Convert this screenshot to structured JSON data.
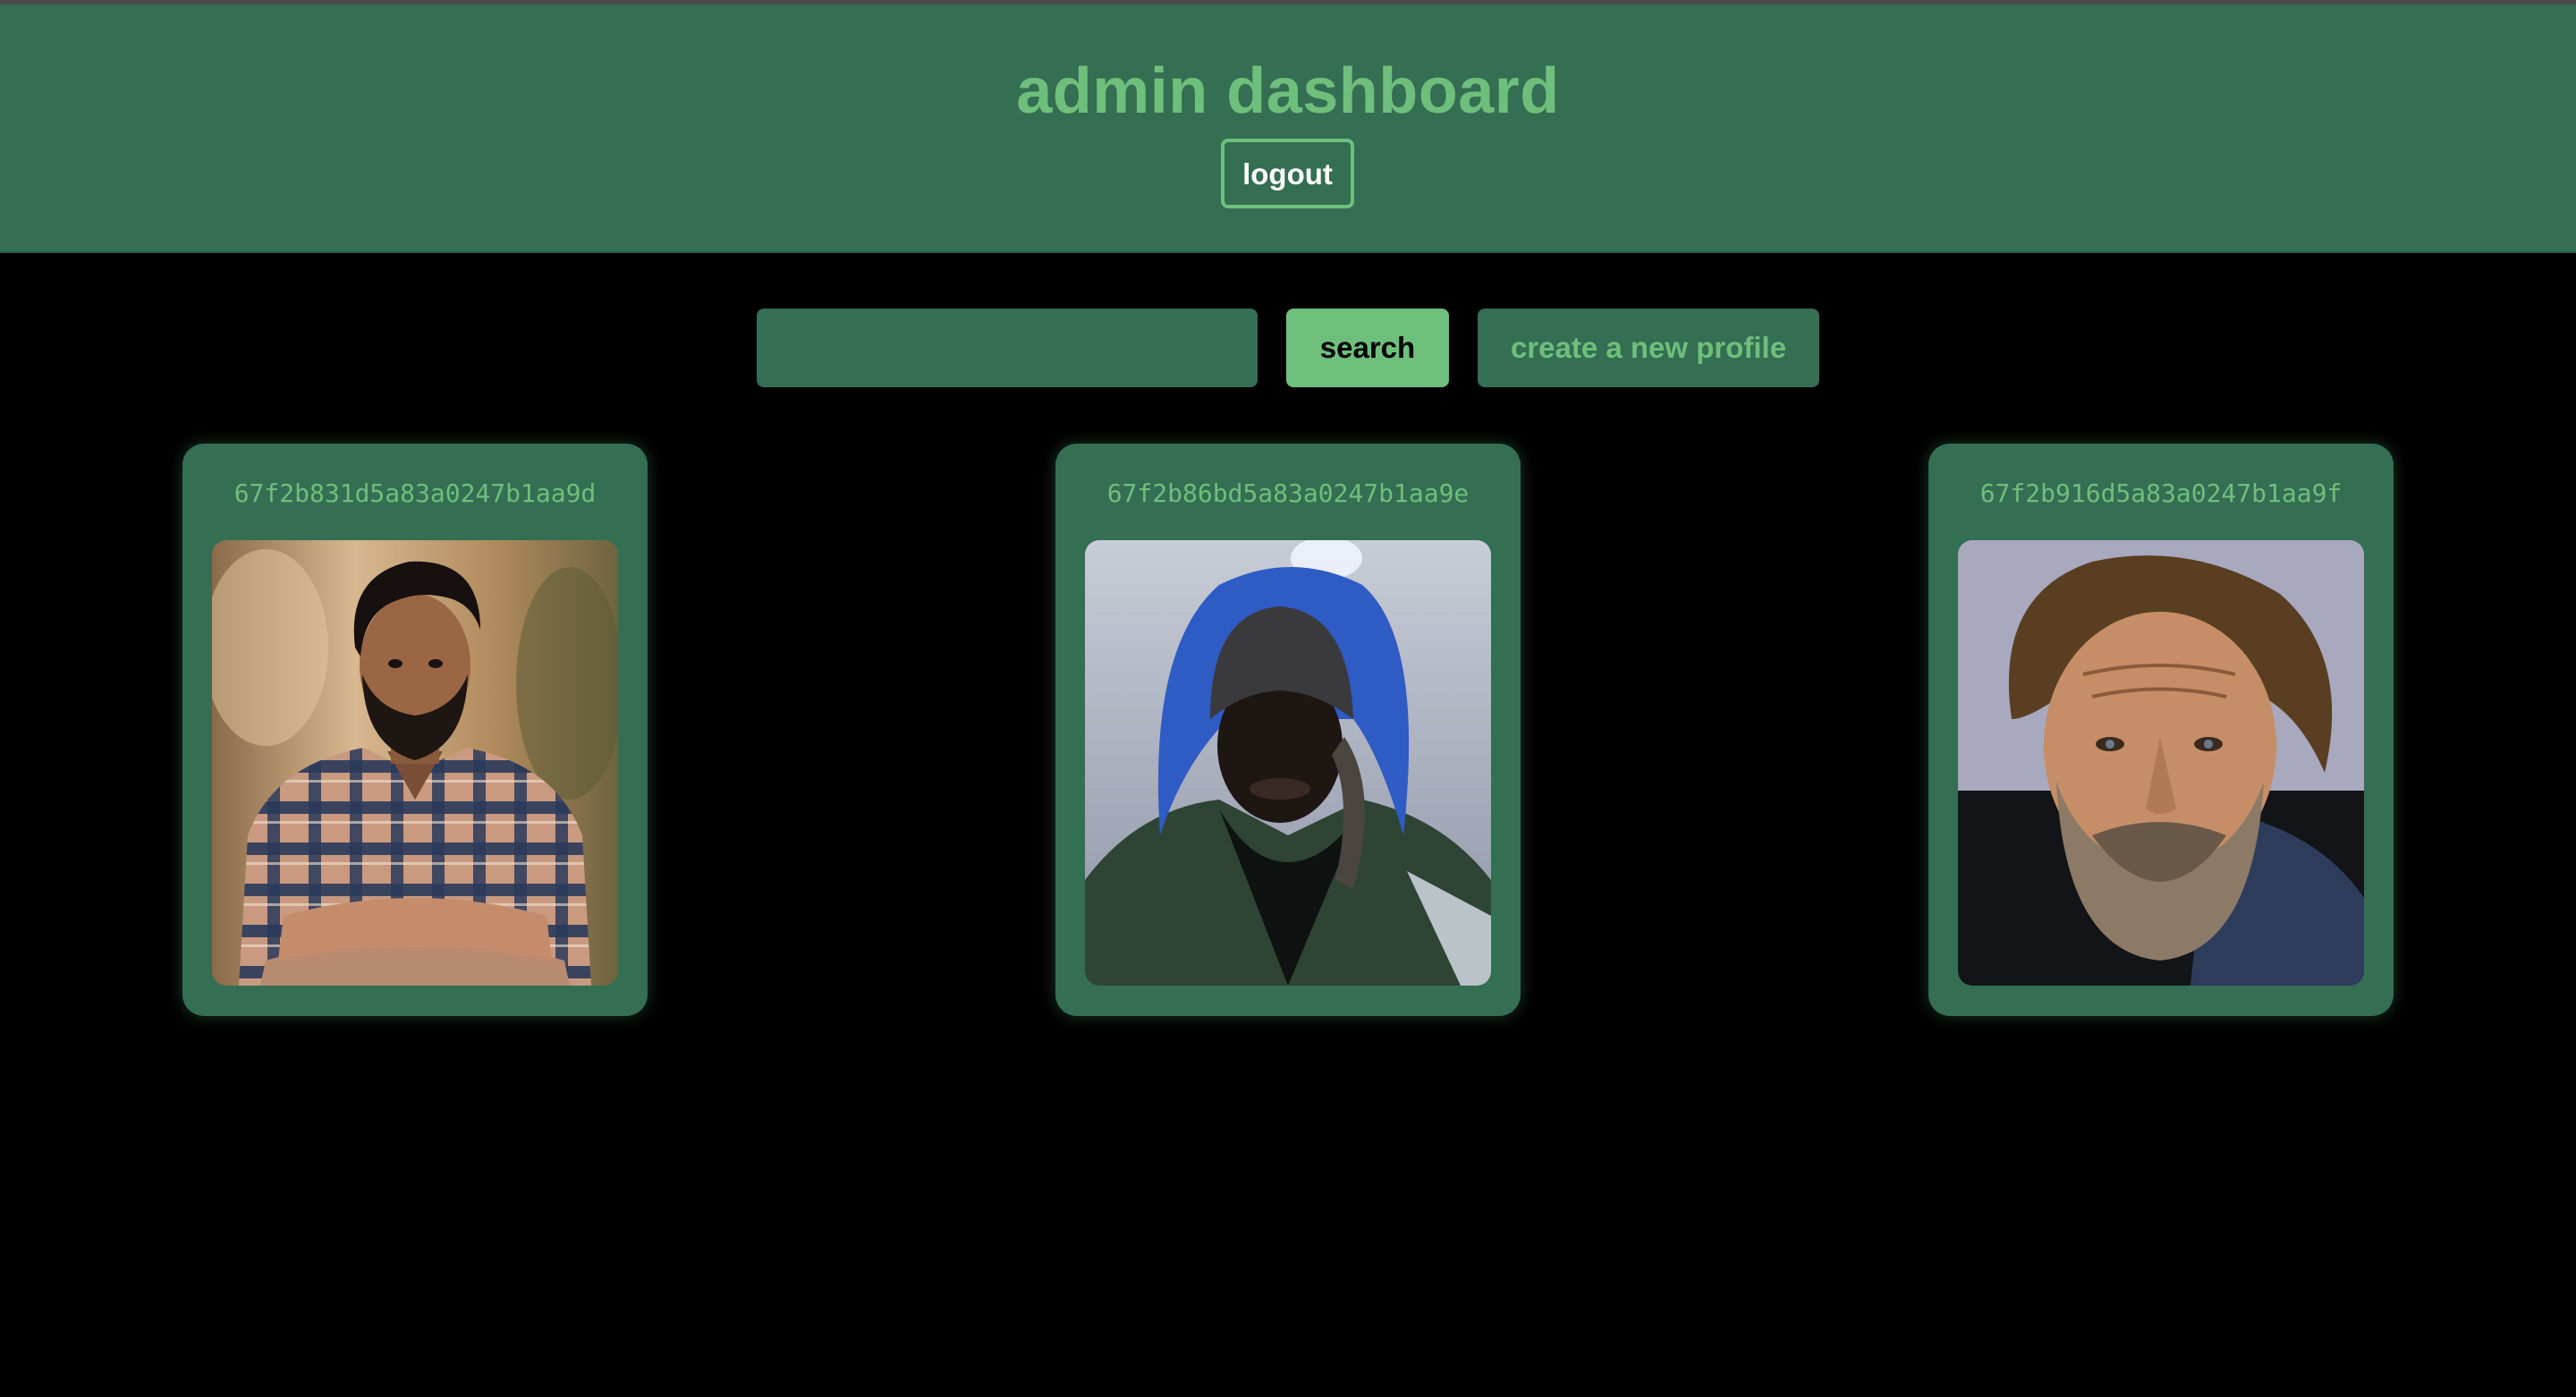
{
  "header": {
    "title": "admin dashboard",
    "logout_label": "logout"
  },
  "toolbar": {
    "search_value": "",
    "search_placeholder": "",
    "search_label": "search",
    "create_label": "create a new profile"
  },
  "profiles": [
    {
      "id": "67f2b831d5a83a0247b1aa9d"
    },
    {
      "id": "67f2b86bd5a83a0247b1aa9e"
    },
    {
      "id": "67f2b916d5a83a0247b1aa9f"
    }
  ],
  "colors": {
    "background": "#000000",
    "panel": "#346e53",
    "accent": "#6fbf7c",
    "text_light": "#ffffff"
  }
}
